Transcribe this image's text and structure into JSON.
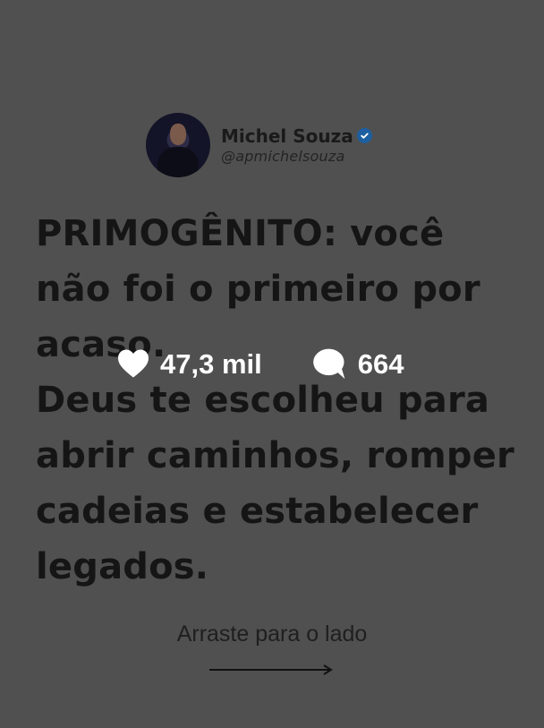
{
  "author": {
    "name": "Michel Souza",
    "handle": "@apmichelsouza",
    "verified": true,
    "avatar_icon": "person-avatar",
    "verified_color": "#1d5fa0"
  },
  "quote": {
    "lines": [
      "PRIMOGÊNITO: você",
      "não foi o primeiro por",
      "acaso.",
      "Deus te escolheu para",
      "abrir caminhos, romper",
      "cadeias e estabelecer",
      "legados."
    ]
  },
  "stats": {
    "likes": "47,3 mil",
    "comments": "664",
    "like_icon": "heart-icon",
    "comment_icon": "speech-bubble-icon"
  },
  "footer": {
    "swipe_label": "Arraste para o lado",
    "arrow_icon": "arrow-right-icon"
  },
  "colors": {
    "background": "#505050",
    "text": "#151515",
    "overlay_text": "#ffffff"
  }
}
